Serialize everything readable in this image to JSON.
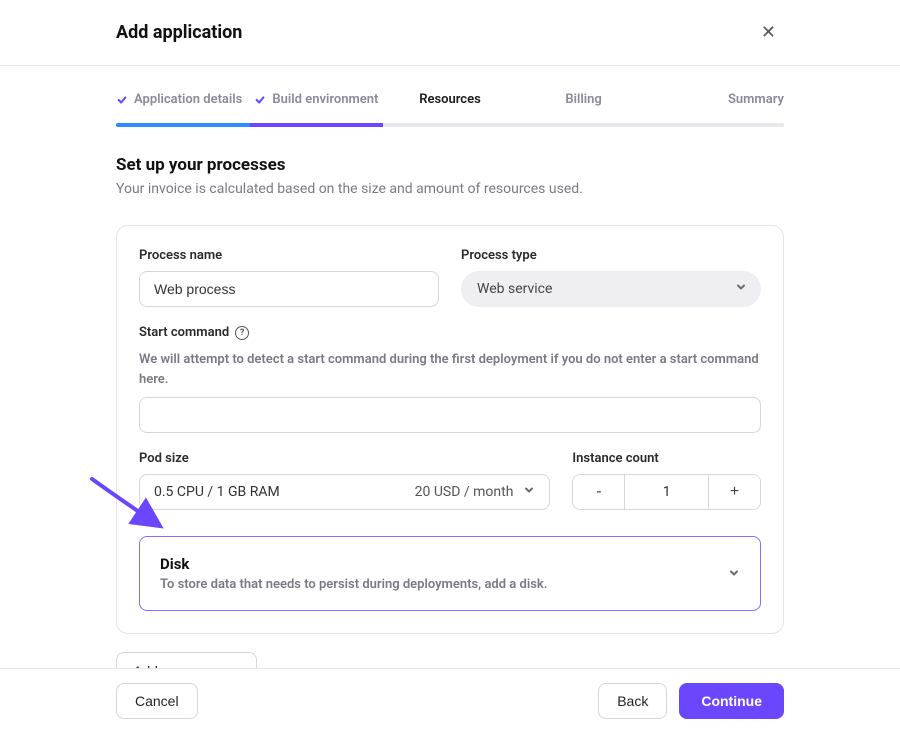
{
  "header": {
    "title": "Add application"
  },
  "stepper": {
    "steps": [
      {
        "label": "Application details",
        "completed": true
      },
      {
        "label": "Build environment",
        "completed": true
      },
      {
        "label": "Resources",
        "active": true
      },
      {
        "label": "Billing"
      },
      {
        "label": "Summary"
      }
    ]
  },
  "section": {
    "heading": "Set up your processes",
    "subtext": "Your invoice is calculated based on the size and amount of resources used."
  },
  "process": {
    "name_label": "Process name",
    "name_value": "Web process",
    "type_label": "Process type",
    "type_value": "Web service",
    "start_label": "Start command",
    "start_hint": "We will attempt to detect a start command during the first deployment if you do not enter a start command here.",
    "start_value": "",
    "pod_label": "Pod size",
    "pod_value": "0.5 CPU / 1 GB RAM",
    "pod_price": "20 USD / month",
    "instance_label": "Instance count",
    "instance_value": "1",
    "instance_minus": "-",
    "instance_plus": "+",
    "disk_title": "Disk",
    "disk_desc": "To store data that needs to persist during deployments, add a disk."
  },
  "actions": {
    "add_process": "Add new process",
    "cancel": "Cancel",
    "back": "Back",
    "continue": "Continue"
  },
  "icons": {
    "help_char": "?"
  }
}
